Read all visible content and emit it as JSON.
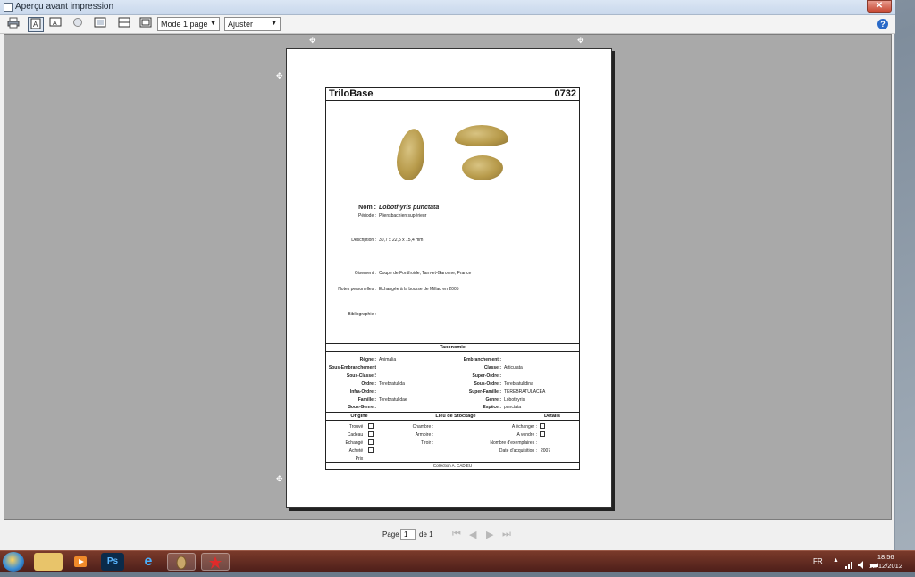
{
  "window": {
    "title": "Aperçu avant impression",
    "close_label": "✕"
  },
  "toolbar": {
    "print_icon": "printer-icon",
    "mode_select": "Mode 1 page",
    "zoom_select": "Ajuster",
    "help_label": "?"
  },
  "card": {
    "app_name": "TriloBase",
    "number": "0732",
    "fields": {
      "nom_label": "Nom :",
      "nom_value": "Lobothyris punctata",
      "periode_label": "Période :",
      "periode_value": "Pliensbachien supérieur",
      "description_label": "Description :",
      "description_value": "30,7 x 22,5 x 15,4 mm",
      "gisement_label": "Gisement :",
      "gisement_value": "Coupe de Fontfroide, Tarn-et-Garonne, France",
      "notes_label": "Notes personelles :",
      "notes_value": "Echangée à la bourse de Millau en 2005",
      "biblio_label": "Bibliographie :"
    },
    "taxonomie": {
      "title": "Taxonomie",
      "left": [
        {
          "label": "Règne :",
          "value": "Animalia"
        },
        {
          "label": "Sous-Embranchement :",
          "value": ""
        },
        {
          "label": "Sous-Classe :",
          "value": ""
        },
        {
          "label": "Ordre :",
          "value": "Terebratulida"
        },
        {
          "label": "Infra-Ordre :",
          "value": ""
        },
        {
          "label": "Famille :",
          "value": "Terebratulidae"
        },
        {
          "label": "Sous-Genre :",
          "value": ""
        }
      ],
      "right": [
        {
          "label": "Embranchement :",
          "value": ""
        },
        {
          "label": "Classe :",
          "value": "Articulata"
        },
        {
          "label": "Super-Ordre :",
          "value": ""
        },
        {
          "label": "Sous-Ordre :",
          "value": "Terebratulidina"
        },
        {
          "label": "Super-Famille :",
          "value": "TEREBRATULACEA"
        },
        {
          "label": "Genre :",
          "value": "Lobothyris"
        },
        {
          "label": "Espèce :",
          "value": "punctata"
        }
      ]
    },
    "bottom": {
      "origine_title": "Origine",
      "stockage_title": "Lieu de Stockage",
      "details_title": "Details",
      "origine": [
        "Trouvé :",
        "Cadeau :",
        "Echangé :",
        "Acheté :",
        "Prix :"
      ],
      "stockage": [
        "Chambre :",
        "Armoire :",
        "Tiroir :"
      ],
      "details": [
        {
          "label": "A échanger :",
          "value": ""
        },
        {
          "label": "A vendre :",
          "value": ""
        },
        {
          "label": "Nombre d'exemplaires :",
          "value": ""
        },
        {
          "label": "Date d'acquisition :",
          "value": "2007"
        }
      ],
      "footer": "Collection A. CADIEU"
    }
  },
  "nav": {
    "page_label": "Page",
    "page_value": "1",
    "of_label": "de 1"
  },
  "taskbar": {
    "lang": "FR",
    "time": "18:56",
    "date": "12/12/2012",
    "apps": [
      "explorer-icon",
      "media-player-icon",
      "photoshop-icon",
      "internet-explorer-icon",
      "trilobase-icon",
      "app-icon"
    ],
    "ps_label": "Ps",
    "ie_label": "e"
  }
}
